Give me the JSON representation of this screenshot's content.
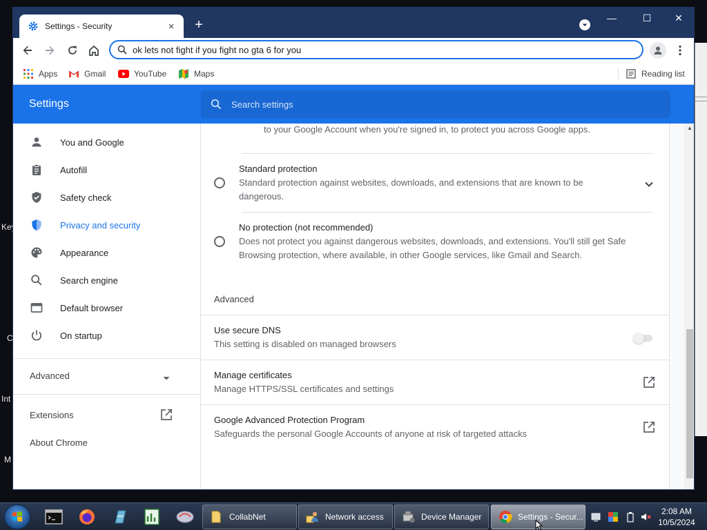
{
  "desktop": {
    "fragments": [
      "Key",
      "C",
      "Int",
      "M"
    ]
  },
  "browser": {
    "tab": {
      "title": "Settings - Security",
      "close": "×"
    },
    "new_tab": "+",
    "window_controls": {
      "minimize": "—",
      "maximize": "☐",
      "close": "✕"
    },
    "address": {
      "value": "ok lets not fight if you fight no gta 6 for you"
    },
    "bookmarks": [
      {
        "label": "Apps",
        "icon": "apps-grid-icon"
      },
      {
        "label": "Gmail",
        "icon": "gmail-icon"
      },
      {
        "label": "YouTube",
        "icon": "youtube-icon"
      },
      {
        "label": "Maps",
        "icon": "maps-icon"
      }
    ],
    "reading_list": "Reading list"
  },
  "settings": {
    "title": "Settings",
    "search_placeholder": "Search settings",
    "sidebar": [
      {
        "label": "You and Google",
        "icon": "person-icon",
        "active": false
      },
      {
        "label": "Autofill",
        "icon": "clipboard-icon",
        "active": false
      },
      {
        "label": "Safety check",
        "icon": "shield-check-icon",
        "active": false
      },
      {
        "label": "Privacy and security",
        "icon": "shield-icon",
        "active": true
      },
      {
        "label": "Appearance",
        "icon": "palette-icon",
        "active": false
      },
      {
        "label": "Search engine",
        "icon": "search-icon",
        "active": false
      },
      {
        "label": "Default browser",
        "icon": "browser-icon",
        "active": false
      },
      {
        "label": "On startup",
        "icon": "power-icon",
        "active": false
      }
    ],
    "advanced_label": "Advanced",
    "extensions_label": "Extensions",
    "about_label": "About Chrome",
    "content": {
      "top_text": "to your Google Account when you're signed in, to protect you across Google apps.",
      "standard": {
        "title": "Standard protection",
        "desc_line1": "Standard protection against websites, downloads, and extensions that are known to be",
        "desc_line2": "dangerous."
      },
      "no_protection": {
        "title": "No protection (not recommended)",
        "desc_line1": "Does not protect you against dangerous websites, downloads, and extensions. You'll still get Safe",
        "desc_line2": "Browsing protection, where available, in other Google services, like Gmail and Search."
      },
      "advanced_heading": "Advanced",
      "secure_dns": {
        "title": "Use secure DNS",
        "desc": "This setting is disabled on managed browsers",
        "enabled": false
      },
      "certificates": {
        "title": "Manage certificates",
        "desc": "Manage HTTPS/SSL certificates and settings"
      },
      "advanced_protection": {
        "title": "Google Advanced Protection Program",
        "desc": "Safeguards the personal Google Accounts of anyone at risk of targeted attacks"
      }
    }
  },
  "taskbar": {
    "tasks": [
      {
        "label": "CollabNet",
        "icon": "folder-icon"
      },
      {
        "label": "Network access",
        "icon": "network-users-icon"
      },
      {
        "label": "Device Manager",
        "icon": "device-manager-icon"
      },
      {
        "label": "Settings - Secur...",
        "icon": "chrome-icon",
        "active": true
      }
    ],
    "clock": {
      "time": "2:08 AM",
      "date": "10/5/2024"
    }
  },
  "colors": {
    "accent": "#1a73e8",
    "titlebar": "#1f3761"
  }
}
